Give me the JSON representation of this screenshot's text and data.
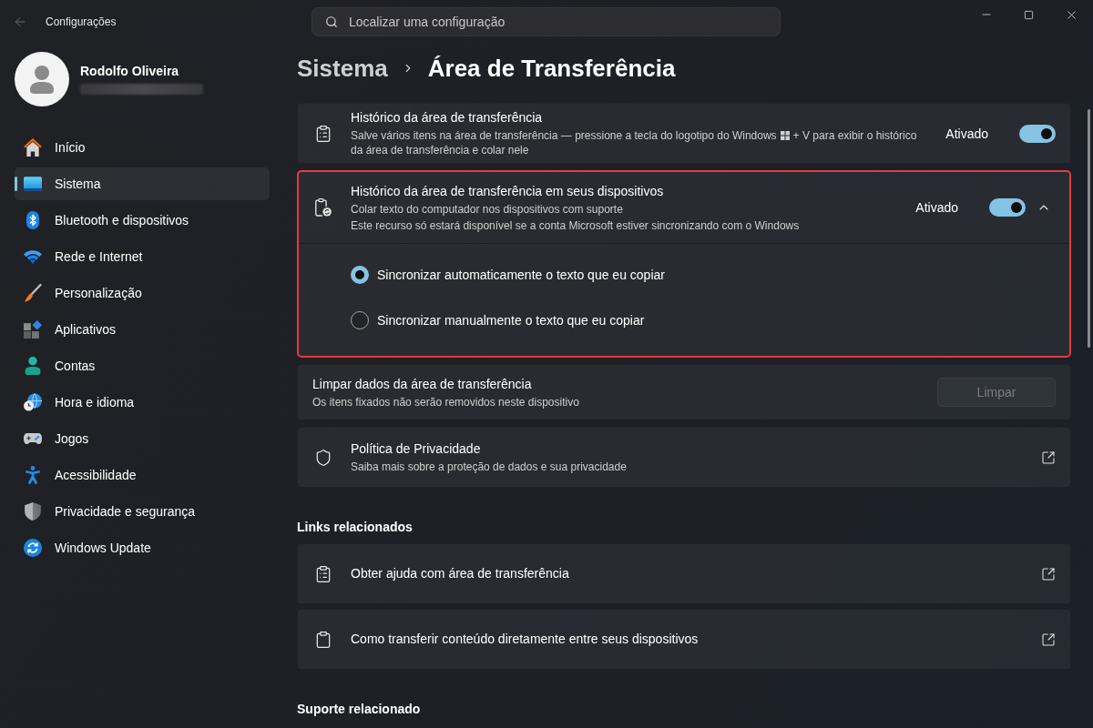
{
  "window": {
    "title": "Configurações"
  },
  "search": {
    "placeholder": "Localizar uma configuração"
  },
  "profile": {
    "name": "Rodolfo Oliveira"
  },
  "sidebar": {
    "items": [
      {
        "label": "Início",
        "selected": false
      },
      {
        "label": "Sistema",
        "selected": true
      },
      {
        "label": "Bluetooth e dispositivos",
        "selected": false
      },
      {
        "label": "Rede e Internet",
        "selected": false
      },
      {
        "label": "Personalização",
        "selected": false
      },
      {
        "label": "Aplicativos",
        "selected": false
      },
      {
        "label": "Contas",
        "selected": false
      },
      {
        "label": "Hora e idioma",
        "selected": false
      },
      {
        "label": "Jogos",
        "selected": false
      },
      {
        "label": "Acessibilidade",
        "selected": false
      },
      {
        "label": "Privacidade e segurança",
        "selected": false
      },
      {
        "label": "Windows Update",
        "selected": false
      }
    ]
  },
  "breadcrumb": {
    "parent": "Sistema",
    "current": "Área de Transferência"
  },
  "settings": [
    {
      "kind": "toggle",
      "title": "Histórico da área de transferência",
      "description_before_key": "Salve vários itens na área de transferência — pressione a tecla do logotipo do Windows",
      "description_after_key": "+ V para exibir o histórico",
      "description_continued": "da área de transferência e colar nele",
      "state_label": "Ativado",
      "on": true
    },
    {
      "kind": "expander",
      "title": "Histórico da área de transferência em seus dispositivos",
      "description_lines": [
        "Colar texto do computador nos dispositivos com suporte",
        "Este recurso só estará disponível se a conta Microsoft estiver sincronizando com o Windows"
      ],
      "state_label": "Ativado",
      "on": true,
      "expanded": true,
      "highlighted": true,
      "options": [
        {
          "label": "Sincronizar automaticamente o texto que eu copiar",
          "selected": true
        },
        {
          "label": "Sincronizar manualmente o texto que eu copiar",
          "selected": false
        }
      ]
    },
    {
      "kind": "action",
      "title": "Limpar dados da área de transferência",
      "description": "Os itens fixados não serão removidos neste dispositivo",
      "button": {
        "label": "Limpar",
        "disabled": true
      }
    },
    {
      "kind": "link",
      "title": "Política de Privacidade",
      "description": "Saiba mais sobre a proteção de dados e sua privacidade"
    }
  ],
  "related_links": {
    "heading": "Links relacionados",
    "items": [
      {
        "label": "Obter ajuda com área de transferência"
      },
      {
        "label": "Como transferir conteúdo diretamente entre seus dispositivos"
      }
    ]
  },
  "related_support": {
    "heading": "Suporte relacionado"
  }
}
